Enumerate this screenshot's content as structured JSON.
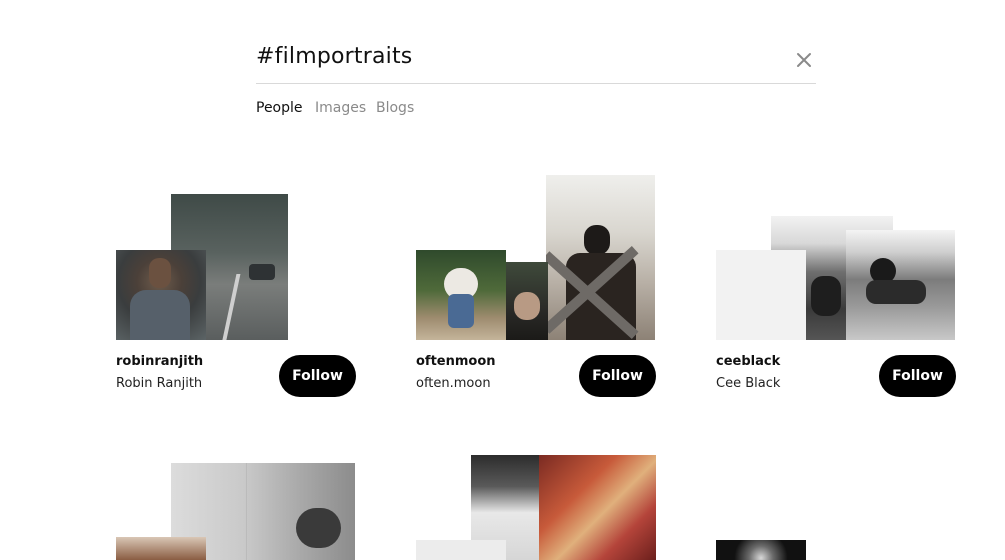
{
  "search": {
    "query": "#filmportraits"
  },
  "tabs": [
    {
      "label": "People",
      "active": true
    },
    {
      "label": "Images",
      "active": false
    },
    {
      "label": "Blogs",
      "active": false
    }
  ],
  "icons": {
    "close": "close-icon"
  },
  "colors": {
    "follow_button_bg": "#000000",
    "follow_button_text": "#ffffff",
    "active_tab": "#111111",
    "inactive_tab": "#8a8a8a"
  },
  "people": [
    {
      "username": "robinranjith",
      "display_name": "Robin Ranjith",
      "follow_label": "Follow"
    },
    {
      "username": "oftenmoon",
      "display_name": "often.moon",
      "follow_label": "Follow"
    },
    {
      "username": "ceeblack",
      "display_name": "Cee Black",
      "follow_label": "Follow"
    }
  ]
}
